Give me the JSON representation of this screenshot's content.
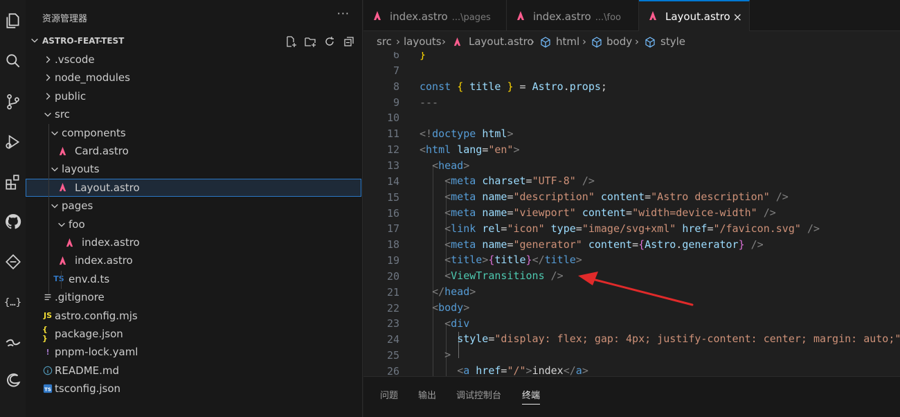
{
  "sidebar": {
    "title": "资源管理器",
    "more": "···",
    "project": "ASTRO-FEAT-TEST",
    "items": [
      {
        "label": ".vscode",
        "kind": "folder-collapsed",
        "depth": 0
      },
      {
        "label": "node_modules",
        "kind": "folder-collapsed",
        "depth": 0
      },
      {
        "label": "public",
        "kind": "folder-collapsed",
        "depth": 0
      },
      {
        "label": "src",
        "kind": "folder-open",
        "depth": 0
      },
      {
        "label": "components",
        "kind": "folder-open",
        "depth": 1
      },
      {
        "label": "Card.astro",
        "kind": "astro",
        "depth": 1
      },
      {
        "label": "layouts",
        "kind": "folder-open",
        "depth": 1
      },
      {
        "label": "Layout.astro",
        "kind": "astro",
        "depth": 1,
        "selected": true
      },
      {
        "label": "pages",
        "kind": "folder-open",
        "depth": 1
      },
      {
        "label": "foo",
        "kind": "folder-open",
        "depth": 2
      },
      {
        "label": "index.astro",
        "kind": "astro",
        "depth": 2
      },
      {
        "label": "index.astro",
        "kind": "astro",
        "depth": 1
      },
      {
        "label": "env.d.ts",
        "kind": "ts",
        "depth": 1
      },
      {
        "label": ".gitignore",
        "kind": "lines",
        "depth": 0
      },
      {
        "label": "astro.config.mjs",
        "kind": "js",
        "depth": 0
      },
      {
        "label": "package.json",
        "kind": "json",
        "depth": 0
      },
      {
        "label": "pnpm-lock.yaml",
        "kind": "yaml",
        "depth": 0
      },
      {
        "label": "README.md",
        "kind": "info",
        "depth": 0
      },
      {
        "label": "tsconfig.json",
        "kind": "tsconfig",
        "depth": 0
      }
    ],
    "icon_glyphs": {
      "ts": "TS",
      "js": "JS",
      "json": "{ }",
      "yaml": "!",
      "info": "i",
      "tsconfig": "TS"
    }
  },
  "tabs": [
    {
      "label": "index.astro",
      "path": "...\\pages",
      "active": false
    },
    {
      "label": "index.astro",
      "path": "...\\foo",
      "active": false
    },
    {
      "label": "Layout.astro",
      "path": "",
      "active": true,
      "close": "×"
    }
  ],
  "breadcrumb": [
    "src",
    "layouts",
    "Layout.astro",
    "html",
    "body",
    "style"
  ],
  "code": {
    "line_numbers": [
      "6",
      "7",
      "8",
      "9",
      "10",
      "11",
      "12",
      "13",
      "14",
      "15",
      "16",
      "17",
      "18",
      "19",
      "20",
      "21",
      "22",
      "23",
      "24",
      "25",
      "26"
    ]
  },
  "panel": {
    "tabs": [
      "问题",
      "输出",
      "调试控制台",
      "终端"
    ],
    "active": "终端"
  },
  "colors": {
    "accent": "#0078d4",
    "astro_icon": "#ff5d8f",
    "ts_icon": "#3178c6",
    "js_icon": "#f1dd35",
    "json_icon": "#f1dd35",
    "yaml_icon": "#a074c4",
    "info_icon": "#519aba",
    "annotation_arrow": "#e02a2a"
  }
}
